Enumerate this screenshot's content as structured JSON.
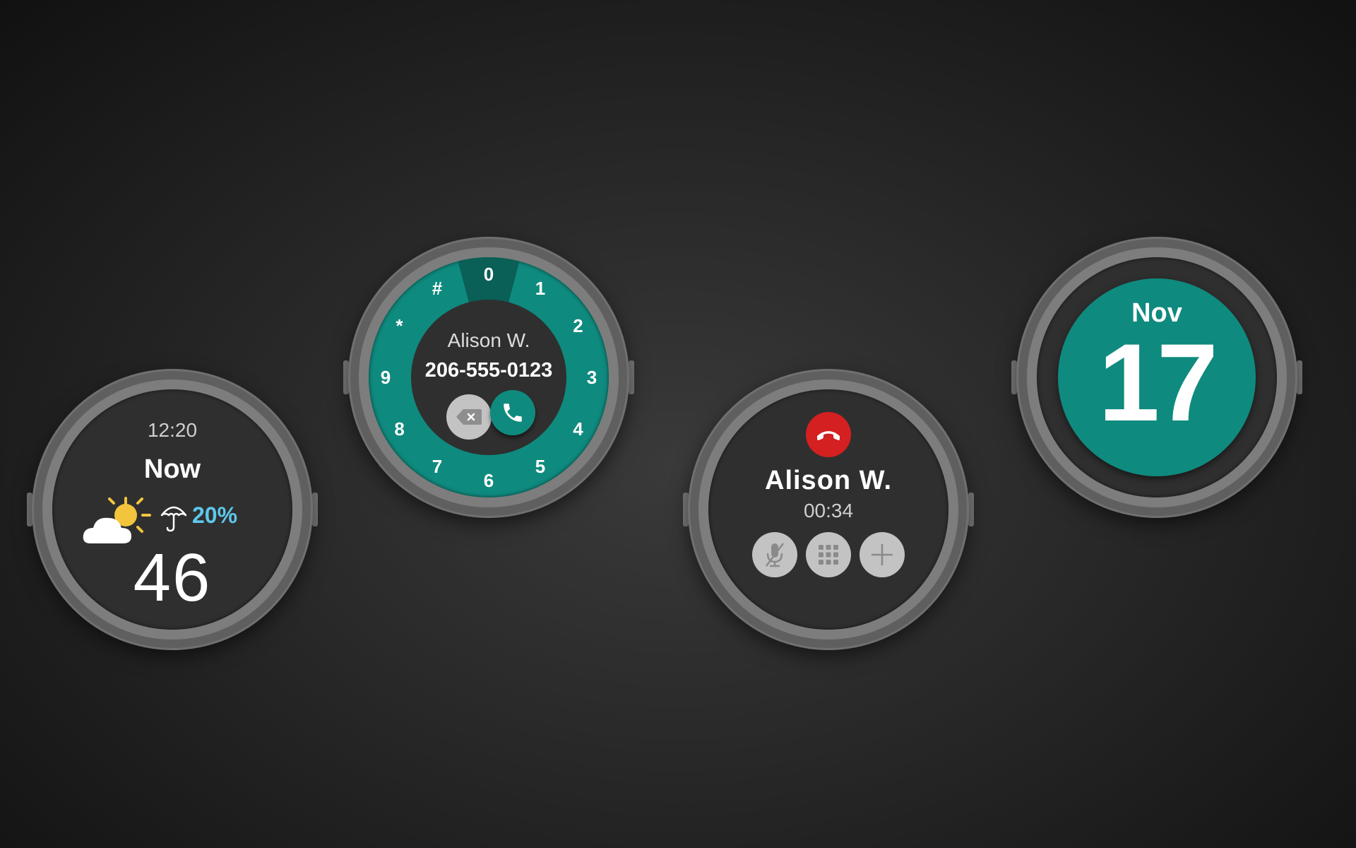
{
  "weather_watch": {
    "time": "12:20",
    "label": "Now",
    "precip": "20%",
    "temperature": "46",
    "weather_icon": "partly-cloudy-icon",
    "umbrella_icon": "umbrella-icon",
    "accent": "#5ec8ec"
  },
  "dialer_watch": {
    "name": "Alison W.",
    "number": "206-555-0123",
    "digits": [
      "0",
      "1",
      "2",
      "3",
      "4",
      "5",
      "6",
      "7",
      "8",
      "9",
      "*",
      "#"
    ],
    "ring_color": "#0f8a7e",
    "selected_digit": "0"
  },
  "call_watch": {
    "name": "Alison W.",
    "duration": "00:34",
    "end_color": "#d42020",
    "actions": [
      "mute-mic-icon",
      "keypad-icon",
      "add-icon"
    ]
  },
  "date_watch": {
    "month": "Nov",
    "day": "17",
    "accent": "#0f8a7e"
  }
}
